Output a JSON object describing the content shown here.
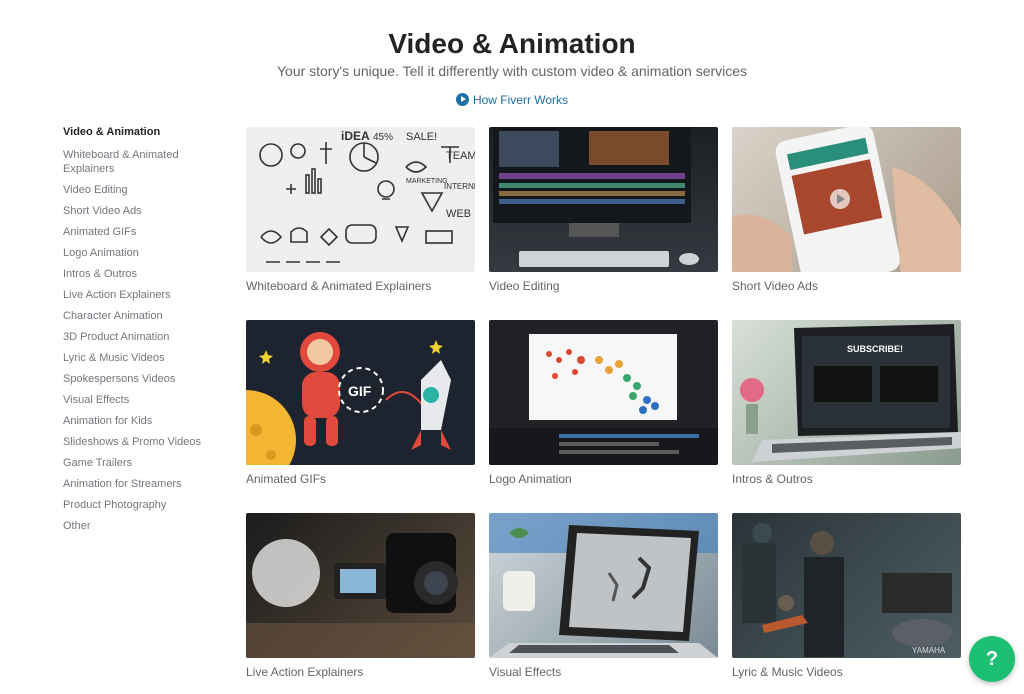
{
  "header": {
    "title": "Video & Animation",
    "subtitle": "Your story's unique. Tell it differently with custom video & animation services",
    "how_link": "How Fiverr Works"
  },
  "sidebar": {
    "title": "Video & Animation",
    "items": [
      "Whiteboard & Animated Explainers",
      "Video Editing",
      "Short Video Ads",
      "Animated GIFs",
      "Logo Animation",
      "Intros & Outros",
      "Live Action Explainers",
      "Character Animation",
      "3D Product Animation",
      "Lyric & Music Videos",
      "Spokespersons Videos",
      "Visual Effects",
      "Animation for Kids",
      "Slideshows & Promo Videos",
      "Game Trailers",
      "Animation for Streamers",
      "Product Photography",
      "Other"
    ]
  },
  "grid": {
    "cards": [
      {
        "label": "Whiteboard & Animated Explainers"
      },
      {
        "label": "Video Editing"
      },
      {
        "label": "Short Video Ads"
      },
      {
        "label": "Animated GIFs",
        "thumb_text": "GIF"
      },
      {
        "label": "Logo Animation"
      },
      {
        "label": "Intros & Outros",
        "thumb_text": "SUBSCRIBE!"
      },
      {
        "label": "Live Action Explainers"
      },
      {
        "label": "Visual Effects"
      },
      {
        "label": "Lyric & Music Videos",
        "thumb_text": "YAMAHA"
      }
    ]
  },
  "thumb_whiteboard": {
    "words": [
      "iDEA",
      "45%",
      "SALE!",
      "TEAM",
      "MARKETING",
      "INTERNET",
      "WEB"
    ]
  },
  "help": {
    "label": "?"
  },
  "colors": {
    "accent": "#1dbf73",
    "link": "#1d6fa5",
    "title": "#222325",
    "muted": "#74767e"
  }
}
